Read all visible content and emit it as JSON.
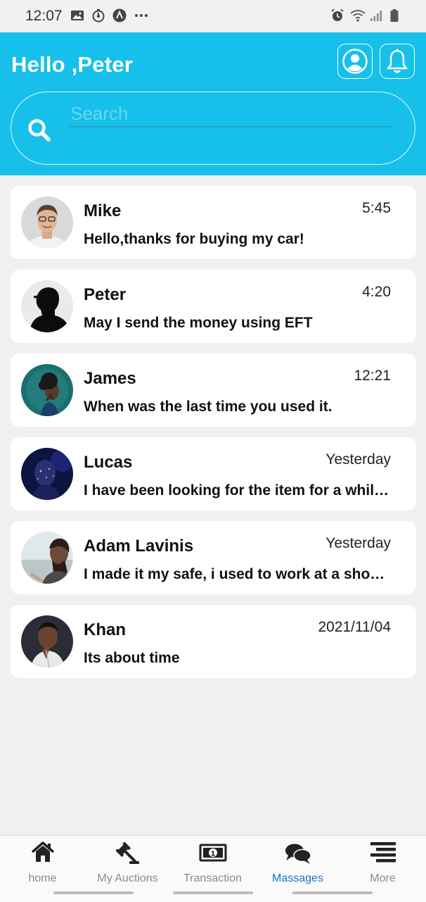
{
  "status_bar": {
    "time": "12:07",
    "left_icons": [
      "image-icon",
      "timer-icon",
      "app-a-icon",
      "more-dots-icon"
    ],
    "right_icons": [
      "alarm-icon",
      "wifi-icon",
      "signal-icon",
      "battery-icon"
    ]
  },
  "header": {
    "greeting": "Hello ,Peter",
    "bg_color": "#16c0ea",
    "search": {
      "placeholder": "Search",
      "value": ""
    }
  },
  "chats": [
    {
      "name": "Mike",
      "time": "5:45",
      "message": "Hello,thanks for buying my car!"
    },
    {
      "name": "Peter",
      "time": "4:20",
      "message": "May I send the money using EFT"
    },
    {
      "name": "James",
      "time": "12:21",
      "message": "When was the last time you used it."
    },
    {
      "name": "Lucas",
      "time": "Yesterday",
      "message": "I have been looking for the item for a while now"
    },
    {
      "name": "Adam Lavinis",
      "time": "Yesterday",
      "message": "I made it my safe, i used to work at a shop near there"
    },
    {
      "name": "Khan",
      "time": "2021/11/04",
      "message": "Its about time"
    }
  ],
  "bottom_nav": {
    "active": "Massages",
    "active_color": "#1a73c9",
    "items": [
      {
        "label": "home",
        "icon": "home-icon"
      },
      {
        "label": "My Auctions",
        "icon": "gavel-icon"
      },
      {
        "label": "Transaction",
        "icon": "banknote-icon"
      },
      {
        "label": "Massages",
        "icon": "chat-bubbles-icon"
      },
      {
        "label": "More",
        "icon": "menu-icon"
      }
    ]
  }
}
